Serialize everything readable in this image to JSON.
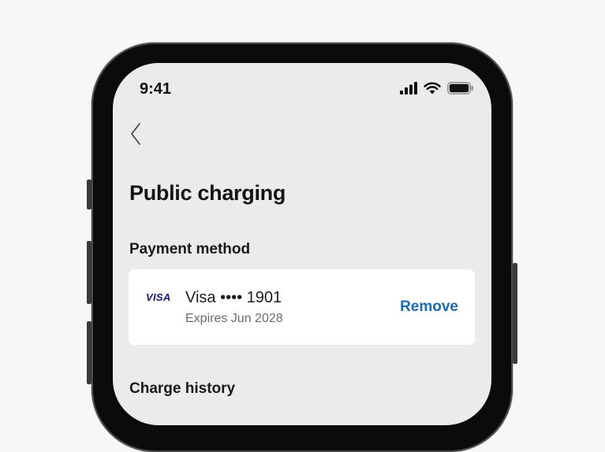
{
  "status_bar": {
    "time": "9:41",
    "icons": [
      "cellular-signal-icon",
      "wifi-icon",
      "battery-icon"
    ]
  },
  "navigation": {
    "back_icon": "chevron-left-icon"
  },
  "page": {
    "title": "Public charging"
  },
  "payment_method": {
    "section_title": "Payment method",
    "card": {
      "brand": "VISA",
      "name": "Visa •••• 1901",
      "expiry": "Expires Jun 2028",
      "action_label": "Remove"
    }
  },
  "charge_history": {
    "section_title": "Charge history"
  },
  "colors": {
    "background": "#ebebeb",
    "card": "#ffffff",
    "accent": "#1f6bb0",
    "visa_blue": "#1a1f71",
    "phone_frame": "#0b0b0b"
  }
}
